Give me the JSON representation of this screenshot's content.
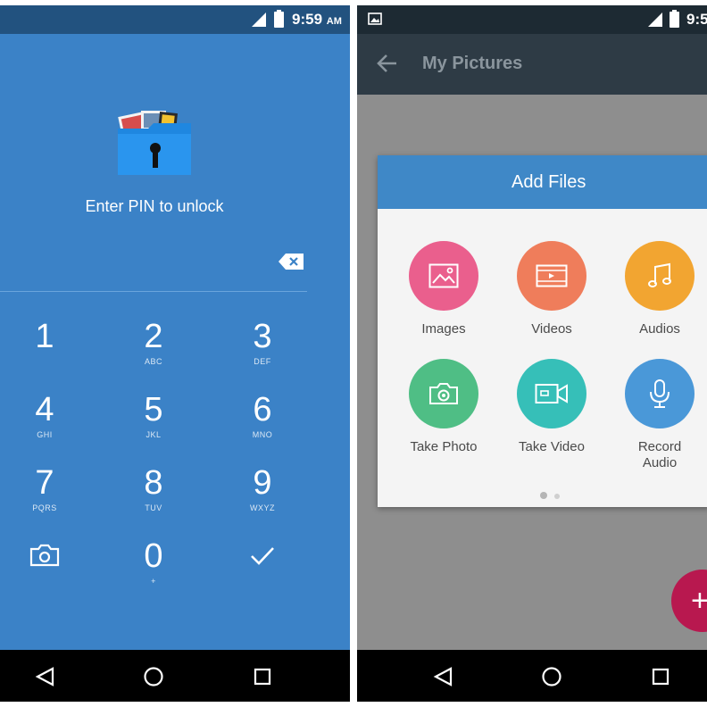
{
  "left_screen": {
    "status": {
      "time": "9:59",
      "ampm": "AM"
    },
    "title": "Enter PIN to unlock",
    "keys": [
      {
        "digit": "1",
        "letters": ""
      },
      {
        "digit": "2",
        "letters": "ABC"
      },
      {
        "digit": "3",
        "letters": "DEF"
      },
      {
        "digit": "4",
        "letters": "GHI"
      },
      {
        "digit": "5",
        "letters": "JKL"
      },
      {
        "digit": "6",
        "letters": "MNO"
      },
      {
        "digit": "7",
        "letters": "PQRS"
      },
      {
        "digit": "8",
        "letters": "TUV"
      },
      {
        "digit": "9",
        "letters": "WXYZ"
      },
      {
        "digit": "0",
        "letters": "+"
      }
    ],
    "icons": [
      "folder-lock-icon",
      "backspace-icon",
      "camera-icon",
      "checkmark-icon"
    ]
  },
  "right_screen": {
    "status": {
      "time": "9:5"
    },
    "app_bar_title": "My Pictures",
    "dialog": {
      "title": "Add Files",
      "options": [
        {
          "label": "Images",
          "icon": "image-icon",
          "color": "#ea5f8d"
        },
        {
          "label": "Videos",
          "icon": "film-icon",
          "color": "#ef7d5b"
        },
        {
          "label": "Audios",
          "icon": "music-note-icon",
          "color": "#f2a531"
        },
        {
          "label": "Take Photo",
          "icon": "camera-icon",
          "color": "#4fbe85"
        },
        {
          "label": "Take Video",
          "icon": "video-camera-icon",
          "color": "#36bfb8"
        },
        {
          "label": "Record Audio",
          "icon": "microphone-icon",
          "color": "#4a98d8"
        }
      ]
    },
    "fab_label": "+"
  },
  "nav_icons": [
    "back-triangle-icon",
    "home-circle-icon",
    "recents-square-icon"
  ],
  "colors": {
    "pin_background": "#3b82c7",
    "status_bar": "#22527f",
    "app_bar": "#2e3b45",
    "dialog_header": "#3f88c7",
    "fab": "#b8184f"
  }
}
